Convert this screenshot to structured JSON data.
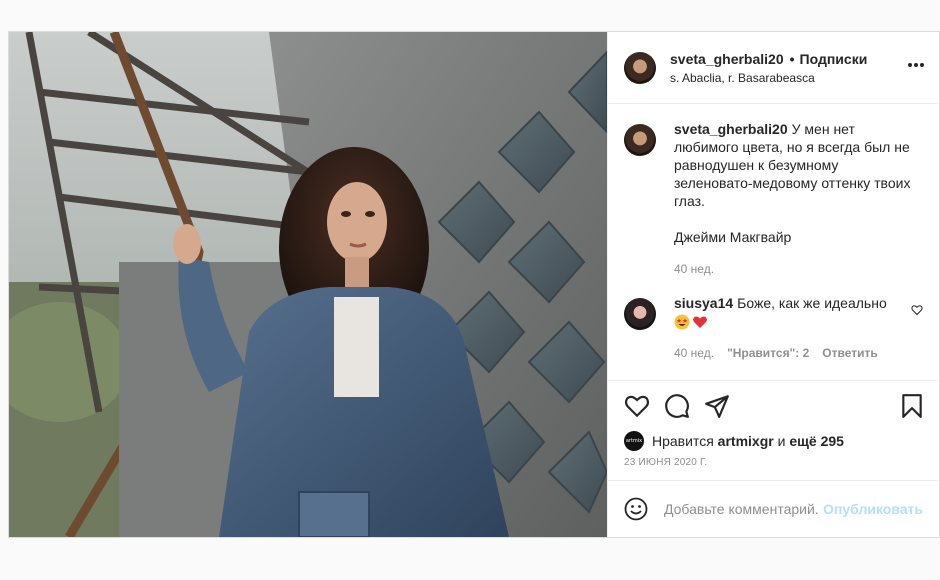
{
  "post": {
    "author": "sveta_gherbali20",
    "separator": "•",
    "follow_label": "Подписки",
    "location": "s. Abaclia, r. Basarabeasca",
    "caption": {
      "username": "sveta_gherbali20",
      "text": "У мен нет любимого цвета, но я всегда был не равнодушен к безумному зеленовато-медовому оттенку твоих глаз.",
      "signature": "Джейми Макгвайр",
      "time": "40 нед."
    },
    "comments": [
      {
        "username": "siusya14",
        "text": "Боже, как же идеально",
        "emojis": [
          "star-struck-emoji",
          "red-heart-emoji"
        ],
        "time": "40 нед.",
        "likes": "\"Нравится\": 2",
        "reply_label": "Ответить"
      }
    ],
    "likes": {
      "avatar_text": "artmix",
      "prefix": "Нравится",
      "user": "artmixgr",
      "and": "и",
      "others": "ещё 295"
    },
    "date": "23 ИЮНЯ 2020 Г.",
    "comment_box": {
      "placeholder": "Добавьте комментарий...",
      "publish_label": "Опубликовать"
    }
  },
  "icons": [
    "more-icon",
    "heart-icon",
    "comment-icon",
    "share-icon",
    "bookmark-icon",
    "emoji-icon",
    "small-heart-icon"
  ],
  "colors": {
    "publish": "#b2dffc",
    "heart": "#ed4956",
    "muted": "#8e8e8e",
    "text": "#262626"
  }
}
